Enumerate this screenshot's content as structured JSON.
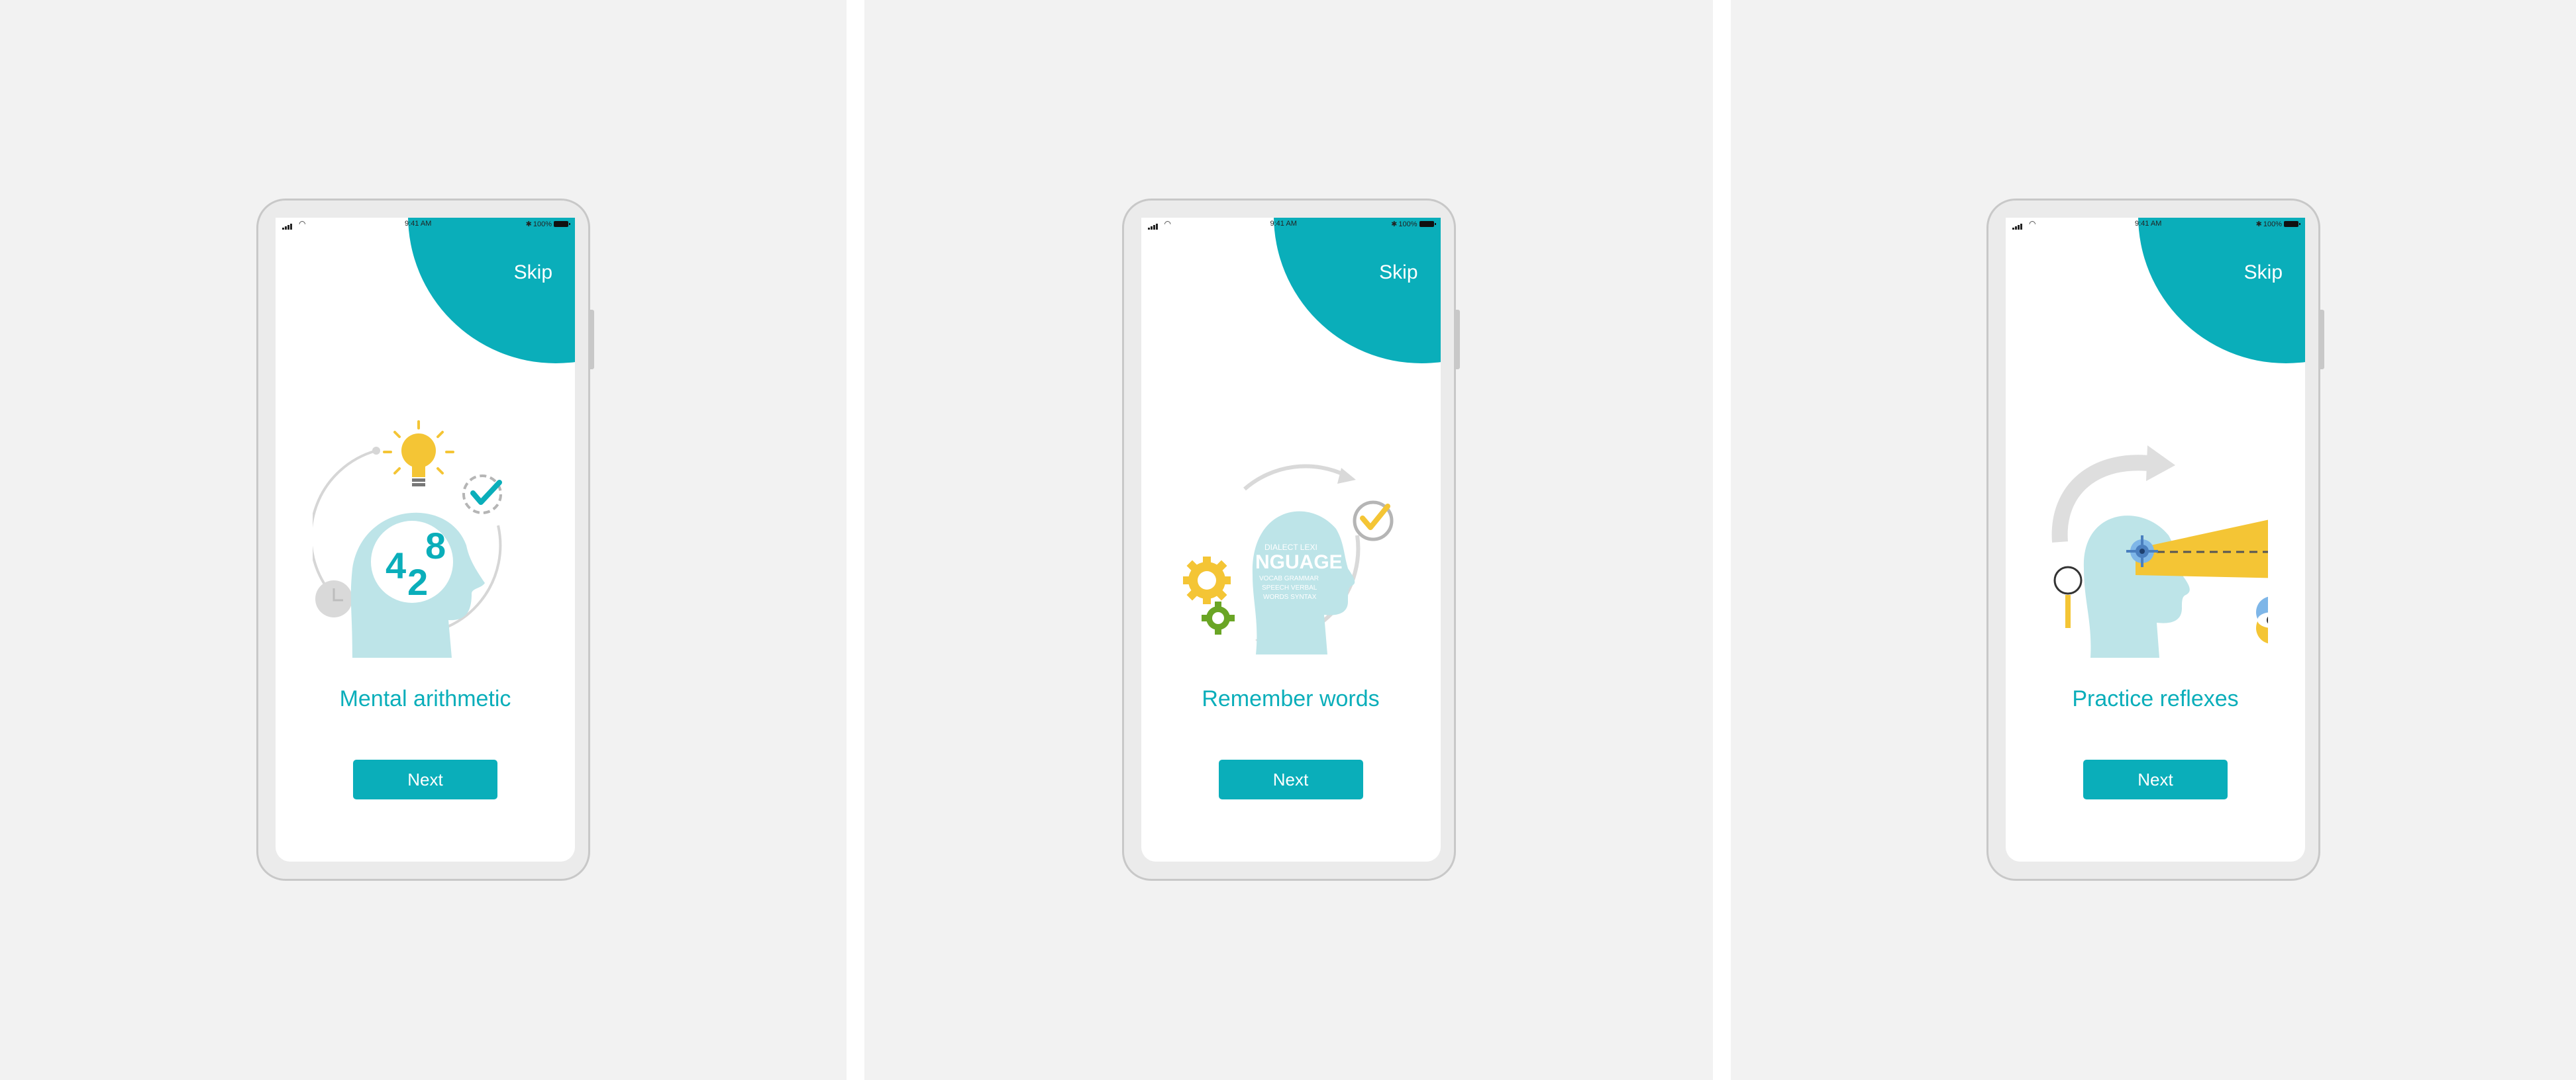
{
  "accent_color": "#0aaeba",
  "status_bar": {
    "time": "9:41 AM",
    "battery": "100%",
    "bluetooth": "✱"
  },
  "screens": [
    {
      "skip": "Skip",
      "title": "Mental arithmetic",
      "next": "Next",
      "illustration": "head-numbers-lightbulb-icon",
      "numbers": [
        "4",
        "2",
        "8"
      ]
    },
    {
      "skip": "Skip",
      "title": "Remember words",
      "next": "Next",
      "illustration": "head-words-gears-icon",
      "word": "NGUAGE"
    },
    {
      "skip": "Skip",
      "title": "Practice reflexes",
      "next": "Next",
      "illustration": "head-eye-target-icon"
    }
  ]
}
